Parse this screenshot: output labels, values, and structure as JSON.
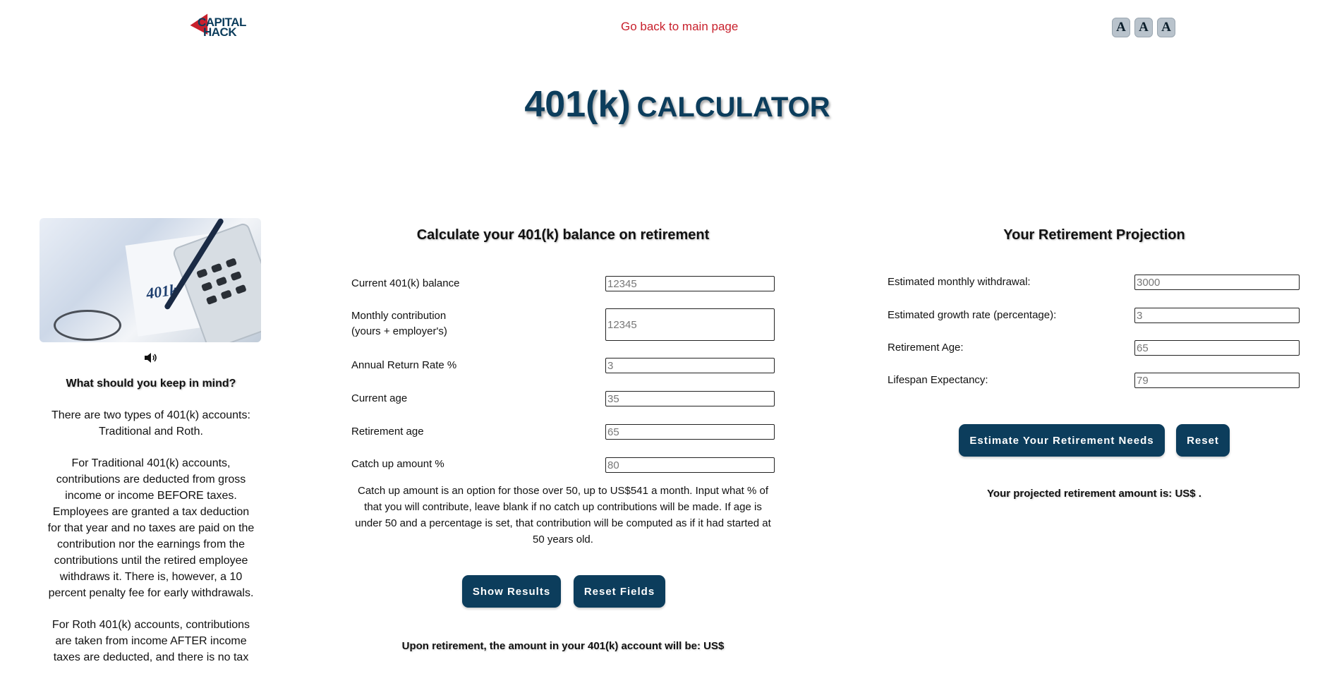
{
  "header": {
    "logo_line1": "CAPITAL",
    "logo_line2": "HACK",
    "back_link": "Go back to main page",
    "font_controls": [
      "A",
      "A",
      "A"
    ],
    "title_big": "401(k)",
    "title_small": "CALCULATOR"
  },
  "sidebar": {
    "image_icon": "401k-calculator-photo",
    "audio_icon": "speaker-icon",
    "heading": "What should you keep in mind?",
    "paragraphs": [
      "There are two types of 401(k) accounts: Traditional and Roth.",
      "For Traditional 401(k) accounts, contributions are deducted from gross income or income BEFORE taxes. Employees are granted a tax deduction for that year and no taxes are paid on the contribution nor the earnings from the contributions until the retired employee withdraws it. There is, however, a 10 percent penalty fee for early withdrawals.",
      "For Roth 401(k) accounts, contributions are taken from income AFTER income taxes are deducted, and there is no tax"
    ],
    "image_text": "401k"
  },
  "calculator": {
    "title": "Calculate your 401(k) balance on retirement",
    "fields": [
      {
        "label": "Current 401(k) balance",
        "placeholder": "12345"
      },
      {
        "label_line1": "Monthly contribution",
        "label_line2": "(yours + employer's)",
        "placeholder": "12345"
      },
      {
        "label": "Annual Return Rate %",
        "placeholder": "3"
      },
      {
        "label": "Current age",
        "placeholder": "35"
      },
      {
        "label": "Retirement age",
        "placeholder": "65"
      },
      {
        "label": "Catch up amount %",
        "placeholder": "80"
      }
    ],
    "catch_up_note": "Catch up amount is an option for those over 50, up to US$541 a month. Input what % of that you will contribute, leave blank if no catch up contributions will be made. If age is under 50 and a percentage is set, that contribution will be computed as if it had started at 50 years old.",
    "show_results": "Show Results",
    "reset_fields": "Reset Fields",
    "result_text": "Upon retirement, the amount in your 401(k) account will be: US$"
  },
  "projection": {
    "title": "Your Retirement Projection",
    "fields": [
      {
        "label": "Estimated monthly withdrawal:",
        "placeholder": "3000"
      },
      {
        "label": "Estimated growth rate (percentage):",
        "placeholder": "3"
      },
      {
        "label": "Retirement Age:",
        "placeholder": "65"
      },
      {
        "label": "Lifespan Expectancy:",
        "placeholder": "79"
      }
    ],
    "estimate_button": "Estimate Your Retirement Needs",
    "reset_button": "Reset",
    "result_text": "Your projected retirement amount is: US$ ."
  }
}
